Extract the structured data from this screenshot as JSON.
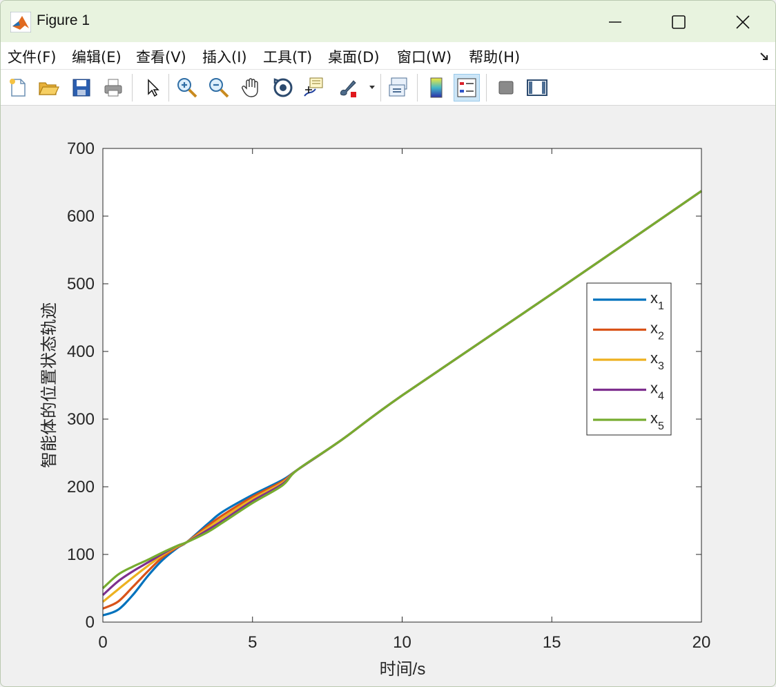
{
  "window": {
    "title": "Figure 1",
    "controls": {
      "minimize": "—",
      "maximize": "☐",
      "close": "✕"
    }
  },
  "menubar": {
    "items": [
      "文件(F)",
      "编辑(E)",
      "查看(V)",
      "插入(I)",
      "工具(T)",
      "桌面(D)",
      "窗口(W)",
      "帮助(H)"
    ]
  },
  "toolbar": {
    "buttons": [
      "new-figure",
      "open-file",
      "save",
      "print",
      "edit-plot-arrow",
      "zoom-in",
      "zoom-out",
      "pan",
      "rotate-3d",
      "data-cursor",
      "brush",
      "link-plot",
      "insert-colorbar",
      "insert-legend",
      "hide-plot-tools",
      "show-plot-tools"
    ],
    "active": "insert-legend"
  },
  "colors": {
    "x1": "#0072BD",
    "x2": "#D95319",
    "x3": "#EDB120",
    "x4": "#7E2F8E",
    "x5": "#77AC30"
  },
  "chart_data": {
    "type": "line",
    "xlabel": "时间/s",
    "ylabel": "智能体的位置状态轨迹",
    "xlim": [
      0,
      20
    ],
    "ylim": [
      0,
      700
    ],
    "xticks": [
      0,
      5,
      10,
      15,
      20
    ],
    "yticks": [
      0,
      100,
      200,
      300,
      400,
      500,
      600,
      700
    ],
    "grid": false,
    "legend": {
      "placement": "right",
      "entries": [
        {
          "base": "x",
          "sub": "1"
        },
        {
          "base": "x",
          "sub": "2"
        },
        {
          "base": "x",
          "sub": "3"
        },
        {
          "base": "x",
          "sub": "4"
        },
        {
          "base": "x",
          "sub": "5"
        }
      ]
    },
    "x": [
      0,
      0.5,
      1,
      1.5,
      2,
      2.5,
      2.8,
      3.5,
      4,
      5,
      6,
      6.5,
      8,
      10,
      15,
      20
    ],
    "series": [
      {
        "name": "x1",
        "color": "#0072BD",
        "values": [
          10,
          18,
          40,
          68,
          92,
          110,
          118,
          145,
          163,
          188,
          210,
          225,
          270,
          335,
          485,
          637
        ]
      },
      {
        "name": "x2",
        "color": "#D95319",
        "values": [
          20,
          30,
          52,
          75,
          96,
          111,
          118,
          142,
          158,
          185,
          208,
          225,
          270,
          335,
          485,
          637
        ]
      },
      {
        "name": "x3",
        "color": "#EDB120",
        "values": [
          30,
          48,
          66,
          83,
          99,
          112,
          118,
          139,
          154,
          182,
          206,
          225,
          270,
          335,
          485,
          637
        ]
      },
      {
        "name": "x4",
        "color": "#7E2F8E",
        "values": [
          40,
          60,
          75,
          88,
          101,
          113,
          118,
          136,
          150,
          179,
          204,
          225,
          270,
          335,
          485,
          637
        ]
      },
      {
        "name": "x5",
        "color": "#77AC30",
        "values": [
          50,
          70,
          82,
          92,
          103,
          113,
          118,
          133,
          147,
          176,
          202,
          225,
          270,
          335,
          485,
          637
        ]
      }
    ]
  }
}
